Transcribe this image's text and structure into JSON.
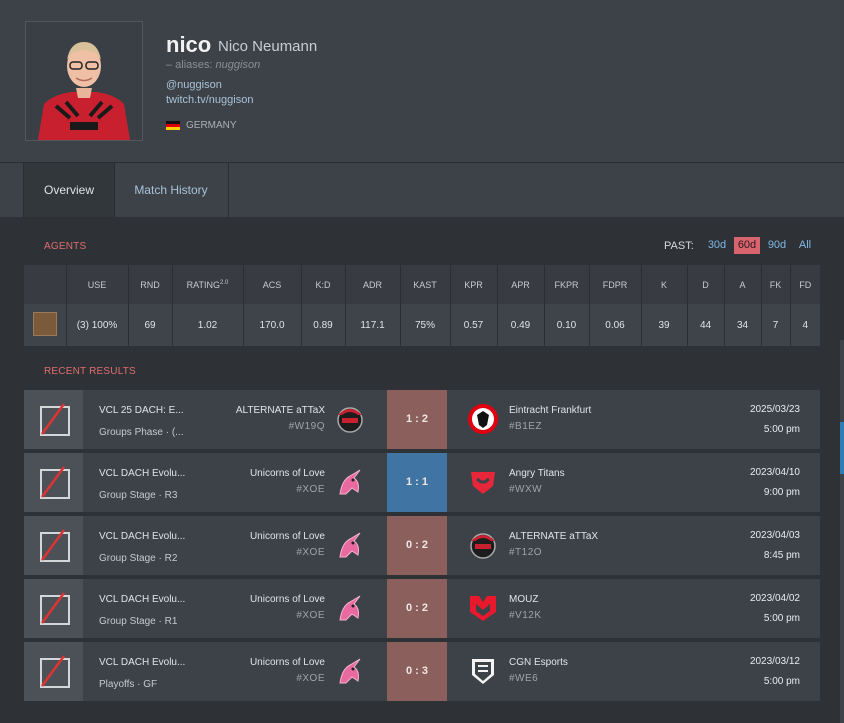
{
  "profile": {
    "handle": "nico",
    "real_name": "Nico Neumann",
    "aliases_prefix": "– aliases:",
    "aliases_value": "nuggison",
    "twitter": "@nuggison",
    "twitch": "twitch.tv/nuggison",
    "country": "GERMANY"
  },
  "tabs": [
    {
      "label": "Overview",
      "active": true
    },
    {
      "label": "Match History",
      "active": false
    }
  ],
  "agents_section": {
    "title": "AGENTS",
    "past_label": "PAST:",
    "filters": [
      "30d",
      "60d",
      "90d",
      "All"
    ],
    "active_filter": "60d",
    "headers": [
      "",
      "USE",
      "RND",
      "RATING2.0",
      "ACS",
      "K:D",
      "ADR",
      "KAST",
      "KPR",
      "APR",
      "FKPR",
      "FDPR",
      "K",
      "D",
      "A",
      "FK",
      "FD"
    ],
    "rating_label": "RATING",
    "rating_sup": "2.0",
    "row": [
      "(3) 100%",
      "69",
      "1.02",
      "170.0",
      "0.89",
      "117.1",
      "75%",
      "0.57",
      "0.49",
      "0.10",
      "0.06",
      "39",
      "44",
      "34",
      "7",
      "4"
    ]
  },
  "results_section": {
    "title": "RECENT RESULTS",
    "matches": [
      {
        "event": "VCL 25 DACH: E...",
        "phase": "Groups Phase · (...",
        "team1": "ALTERNATE aTTaX",
        "team1_tag": "#W19Q",
        "score": "1 : 2",
        "result": "loss",
        "team2": "Eintracht Frankfurt",
        "team2_tag": "#B1EZ",
        "date": "2025/03/23",
        "time": "5:00 pm",
        "team1_logo": "alternate-logo",
        "team2_logo": "eintracht-logo"
      },
      {
        "event": "VCL DACH Evolu...",
        "phase": "Group Stage · R3",
        "team1": "Unicorns of Love",
        "team1_tag": "#XOE",
        "score": "1 : 1",
        "result": "draw",
        "team2": "Angry Titans",
        "team2_tag": "#WXW",
        "date": "2023/04/10",
        "time": "9:00 pm",
        "team1_logo": "unicorns-logo",
        "team2_logo": "angry-titans-logo"
      },
      {
        "event": "VCL DACH Evolu...",
        "phase": "Group Stage · R2",
        "team1": "Unicorns of Love",
        "team1_tag": "#XOE",
        "score": "0 : 2",
        "result": "loss",
        "team2": "ALTERNATE aTTaX",
        "team2_tag": "#T12O",
        "date": "2023/04/03",
        "time": "8:45 pm",
        "team1_logo": "unicorns-logo",
        "team2_logo": "alternate-logo"
      },
      {
        "event": "VCL DACH Evolu...",
        "phase": "Group Stage · R1",
        "team1": "Unicorns of Love",
        "team1_tag": "#XOE",
        "score": "0 : 2",
        "result": "loss",
        "team2": "MOUZ",
        "team2_tag": "#V12K",
        "date": "2023/04/02",
        "time": "5:00 pm",
        "team1_logo": "unicorns-logo",
        "team2_logo": "mouz-logo"
      },
      {
        "event": "VCL DACH Evolu...",
        "phase": "Playoffs · GF",
        "team1": "Unicorns of Love",
        "team1_tag": "#XOE",
        "score": "0 : 3",
        "result": "loss",
        "team2": "CGN Esports",
        "team2_tag": "#WE6",
        "date": "2023/03/12",
        "time": "5:00 pm",
        "team1_logo": "unicorns-logo",
        "team2_logo": "cgn-logo"
      }
    ]
  },
  "colors": {
    "loss": "#8a5f5c",
    "draw": "#3f74a3",
    "accent_red": "#e06d6d",
    "link_blue": "#7fb7e6"
  }
}
